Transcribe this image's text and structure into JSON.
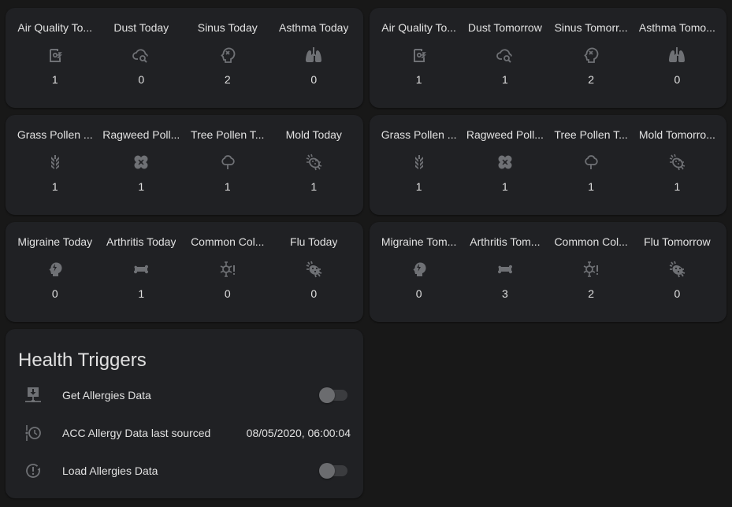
{
  "glance_cards": [
    {
      "id": "aq-today",
      "items": [
        {
          "name": "Air Quality Today",
          "display": "Air Quality To...",
          "icon": "air-quality-icon",
          "value": "1"
        },
        {
          "name": "Dust Today",
          "display": "Dust Today",
          "icon": "cloud-search-icon",
          "value": "0"
        },
        {
          "name": "Sinus Today",
          "display": "Sinus Today",
          "icon": "head-remove-icon",
          "value": "2"
        },
        {
          "name": "Asthma Today",
          "display": "Asthma Today",
          "icon": "lungs-icon",
          "value": "0"
        }
      ]
    },
    {
      "id": "aq-tomorrow",
      "items": [
        {
          "name": "Air Quality Tomorrow",
          "display": "Air Quality To...",
          "icon": "air-quality-icon",
          "value": "1"
        },
        {
          "name": "Dust Tomorrow",
          "display": "Dust Tomorrow",
          "icon": "cloud-search-icon",
          "value": "1"
        },
        {
          "name": "Sinus Tomorrow",
          "display": "Sinus Tomorr...",
          "icon": "head-remove-icon",
          "value": "2"
        },
        {
          "name": "Asthma Tomorrow",
          "display": "Asthma Tomo...",
          "icon": "lungs-icon",
          "value": "0"
        }
      ]
    },
    {
      "id": "pollen-today",
      "items": [
        {
          "name": "Grass Pollen Today",
          "display": "Grass Pollen ...",
          "icon": "grain-icon",
          "value": "1"
        },
        {
          "name": "Ragweed Pollen Today",
          "display": "Ragweed Poll...",
          "icon": "clover-icon",
          "value": "1"
        },
        {
          "name": "Tree Pollen Today",
          "display": "Tree Pollen T...",
          "icon": "tree-icon",
          "value": "1"
        },
        {
          "name": "Mold Today",
          "display": "Mold Today",
          "icon": "bacteria-outline-icon",
          "value": "1"
        }
      ]
    },
    {
      "id": "pollen-tomorrow",
      "items": [
        {
          "name": "Grass Pollen Tomorrow",
          "display": "Grass Pollen ...",
          "icon": "grain-icon",
          "value": "1"
        },
        {
          "name": "Ragweed Pollen Tomorrow",
          "display": "Ragweed Poll...",
          "icon": "clover-icon",
          "value": "1"
        },
        {
          "name": "Tree Pollen Tomorrow",
          "display": "Tree Pollen T...",
          "icon": "tree-icon",
          "value": "1"
        },
        {
          "name": "Mold Tomorrow",
          "display": "Mold Tomorro...",
          "icon": "bacteria-outline-icon",
          "value": "1"
        }
      ]
    },
    {
      "id": "illness-today",
      "items": [
        {
          "name": "Migraine Today",
          "display": "Migraine Today",
          "icon": "head-flash-icon",
          "value": "0"
        },
        {
          "name": "Arthritis Today",
          "display": "Arthritis Today",
          "icon": "bone-icon",
          "value": "1"
        },
        {
          "name": "Common Cold Today",
          "display": "Common Col...",
          "icon": "virus-alert-icon",
          "value": "0"
        },
        {
          "name": "Flu Today",
          "display": "Flu Today",
          "icon": "bacteria-icon",
          "value": "0"
        }
      ]
    },
    {
      "id": "illness-tomorrow",
      "items": [
        {
          "name": "Migraine Tomorrow",
          "display": "Migraine Tom...",
          "icon": "head-flash-icon",
          "value": "0"
        },
        {
          "name": "Arthritis Tomorrow",
          "display": "Arthritis Tom...",
          "icon": "bone-icon",
          "value": "3"
        },
        {
          "name": "Common Cold Tomorrow",
          "display": "Common Col...",
          "icon": "virus-alert-icon",
          "value": "2"
        },
        {
          "name": "Flu Tomorrow",
          "display": "Flu Tomorrow",
          "icon": "bacteria-icon",
          "value": "0"
        }
      ]
    }
  ],
  "health_triggers": {
    "title": "Health Triggers",
    "rows": [
      {
        "label": "Get Allergies Data",
        "icon": "download-network-icon",
        "type": "toggle",
        "state": "off"
      },
      {
        "label": "ACC Allergy Data last sourced",
        "icon": "timeline-clock-icon",
        "type": "value",
        "value": "08/05/2020, 06:00:04"
      },
      {
        "label": "Load Allergies Data",
        "icon": "restore-alert-icon",
        "type": "toggle",
        "state": "off"
      }
    ]
  },
  "colors": {
    "background": "#181818",
    "card": "#202124",
    "text": "#e1e1e1",
    "icon": "#6f7175",
    "toggle_knob": "#6b6c6f",
    "toggle_track": "#3b3c3f"
  }
}
